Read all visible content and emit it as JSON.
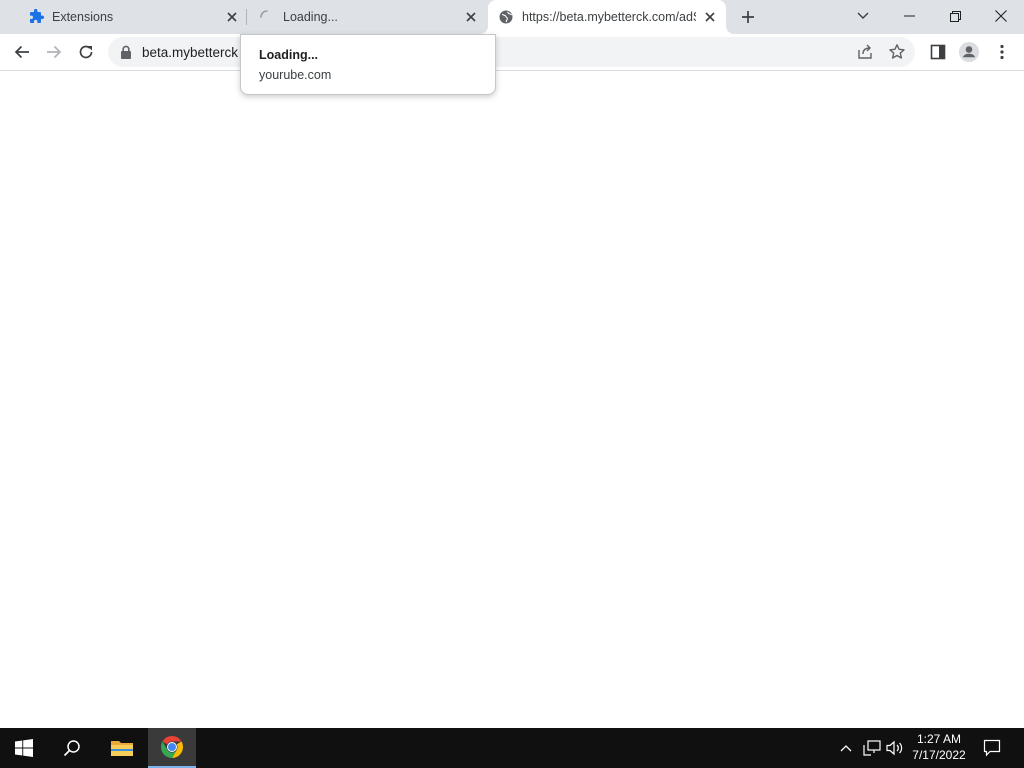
{
  "tabs": [
    {
      "title": "Extensions",
      "icon": "puzzle-icon",
      "active": false
    },
    {
      "title": "Loading...",
      "icon": "spinner-icon",
      "active": false
    },
    {
      "title": "https://beta.mybetterck.com/adS",
      "icon": "globe-icon",
      "active": true
    }
  ],
  "omnibox": {
    "url": "beta.mybetterck"
  },
  "hovercard": {
    "title": "Loading...",
    "domain": "yourube.com"
  },
  "taskbar": {
    "time": "1:27 AM",
    "date": "7/17/2022"
  },
  "colors": {
    "tabstrip": "#dee1e6",
    "accent_blue": "#1a73e8",
    "taskbar": "#101010"
  }
}
